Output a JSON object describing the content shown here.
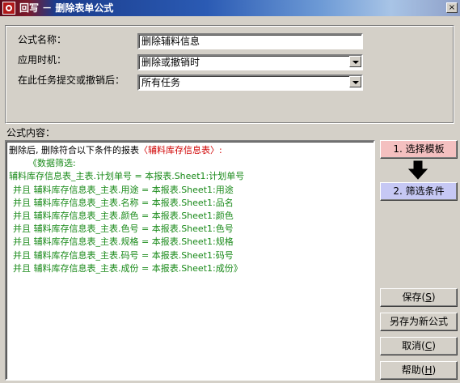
{
  "window": {
    "title": "回写 － 删除表单公式",
    "close_glyph": "×"
  },
  "form": {
    "name_label": "公式名称：",
    "name_value": "删除辅料信息",
    "timing_label": "应用时机：",
    "timing_value": "删除或撤销时",
    "task_label": "在此任务提交或撤销后：",
    "task_value": "所有任务"
  },
  "formula": {
    "label": "公式内容：",
    "lines": [
      "删除后, 删除符合以下条件的报表",
      "〈辅料库存信息表〉:",
      "《数据筛选:",
      "辅料库存信息表_主表.计划单号 = 本报表.Sheet1:计划单号",
      "并且 辅料库存信息表_主表.用途 = 本报表.Sheet1:用途",
      "并且 辅料库存信息表_主表.名称 = 本报表.Sheet1:品名",
      "并且 辅料库存信息表_主表.颜色 = 本报表.Sheet1:颜色",
      "并且 辅料库存信息表_主表.色号 = 本报表.Sheet1:色号",
      "并且 辅料库存信息表_主表.规格 = 本报表.Sheet1:规格",
      "并且 辅料库存信息表_主表.码号 = 本报表.Sheet1:码号",
      "并且 辅料库存信息表_主表.成份 = 本报表.Sheet1:成份》"
    ]
  },
  "buttons": {
    "select_template": "1. 选择模板",
    "filter": "2. 筛选条件",
    "save": "保存",
    "save_key": "S",
    "save_as": "另存为新公式",
    "cancel": "取消",
    "cancel_key": "C",
    "help": "帮助",
    "help_key": "H"
  },
  "icons": [
    "app-icon",
    "close-icon",
    "down-arrow-icon",
    "dropdown-arrow-icon"
  ],
  "colors": {
    "select_template_bg": "#f4c0c0",
    "filter_bg": "#c6c8f4",
    "formula_green": "#1a8a1a",
    "formula_red": "#d00000"
  }
}
